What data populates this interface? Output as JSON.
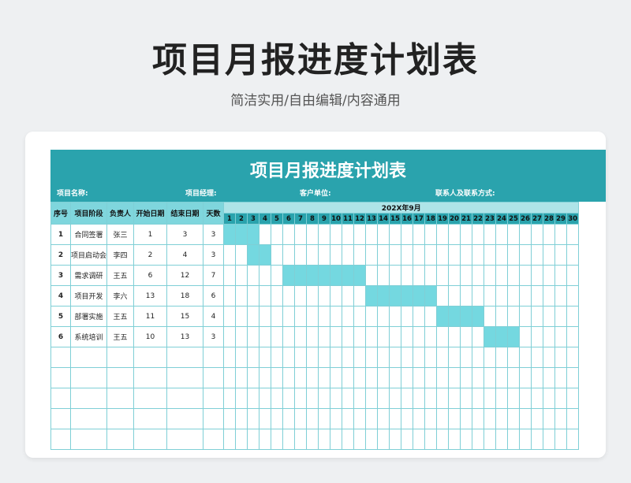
{
  "page": {
    "title": "项目月报进度计划表",
    "subtitle": "简洁实用/自由编辑/内容通用"
  },
  "sheet": {
    "title": "项目月报进度计划表",
    "meta": {
      "project_name": "项目名称:",
      "project_manager": "项目经理:",
      "client": "客户单位:",
      "contact": "联系人及联系方式:"
    },
    "headers": {
      "index": "序号",
      "stage": "项目阶段",
      "owner": "负责人",
      "start": "开始日期",
      "end": "结束日期",
      "days": "天数"
    },
    "month_label": "202X年9月",
    "day_count": 30,
    "empty_rows": 5,
    "bar_color": "#74d8e0",
    "header_color": "#2aa3ad",
    "rows": [
      {
        "index": "1",
        "stage": "合同签署",
        "owner": "张三",
        "start": "1",
        "end": "3",
        "days": "3"
      },
      {
        "index": "2",
        "stage": "项目启动会",
        "owner": "李四",
        "start": "2",
        "end": "4",
        "days": "3"
      },
      {
        "index": "3",
        "stage": "需求调研",
        "owner": "王五",
        "start": "6",
        "end": "12",
        "days": "7"
      },
      {
        "index": "4",
        "stage": "项目开发",
        "owner": "李六",
        "start": "13",
        "end": "18",
        "days": "6"
      },
      {
        "index": "5",
        "stage": "部署实施",
        "owner": "王五",
        "start": "11",
        "end": "15",
        "days": "4"
      },
      {
        "index": "6",
        "stage": "系统培训",
        "owner": "王五",
        "start": "10",
        "end": "13",
        "days": "3"
      }
    ],
    "gantt_bars": [
      {
        "start": 1,
        "end": 3
      },
      {
        "start": 3,
        "end": 4
      },
      {
        "start": 6,
        "end": 12
      },
      {
        "start": 13,
        "end": 18
      },
      {
        "start": 19,
        "end": 22
      },
      {
        "start": 23,
        "end": 25
      }
    ]
  }
}
